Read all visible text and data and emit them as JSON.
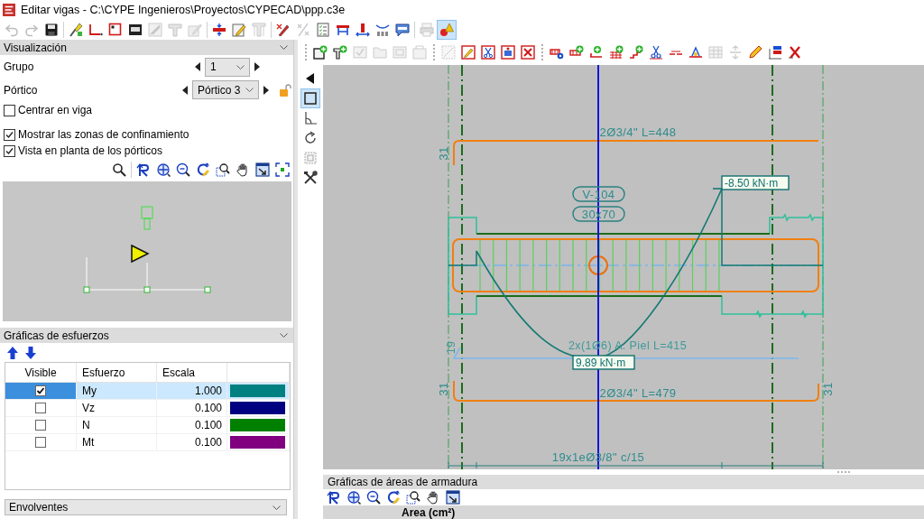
{
  "window": {
    "title": "Editar vigas - C:\\CYPE Ingenieros\\Proyectos\\CYPECAD\\ppp.c3e"
  },
  "toolbar": {
    "buttons": [
      {
        "selected": false,
        "disabled": true
      },
      {
        "selected": false,
        "disabled": true
      },
      {
        "selected": false,
        "disabled": false
      },
      {
        "selected": false,
        "disabled": false
      },
      {
        "selected": false,
        "disabled": false
      },
      {
        "selected": false,
        "disabled": false
      },
      {
        "selected": false,
        "disabled": false
      },
      {
        "selected": false,
        "disabled": true
      },
      {
        "selected": false,
        "disabled": true
      },
      {
        "selected": false,
        "disabled": true
      },
      {
        "selected": false,
        "disabled": false
      },
      {
        "selected": false,
        "disabled": false
      },
      {
        "selected": false,
        "disabled": true
      },
      {
        "selected": false,
        "disabled": false
      },
      {
        "selected": false,
        "disabled": true
      },
      {
        "selected": false,
        "disabled": false
      },
      {
        "selected": false,
        "disabled": false
      },
      {
        "selected": false,
        "disabled": false
      },
      {
        "selected": false,
        "disabled": false
      },
      {
        "selected": false,
        "disabled": false
      },
      {
        "selected": false,
        "disabled": true
      },
      {
        "selected": true,
        "disabled": false
      }
    ]
  },
  "visualization_panel": {
    "title": "Visualización",
    "fields": [
      {
        "label": "Grupo",
        "value": "1"
      },
      {
        "label": "Pórtico",
        "value": "Pórtico 3"
      }
    ],
    "checkboxes": [
      {
        "label": "Centrar en viga",
        "checked": false
      },
      {
        "label": "Mostrar las zonas de confinamiento",
        "checked": true
      },
      {
        "label": "Vista en planta de los pórticos",
        "checked": true
      }
    ]
  },
  "forces_panel": {
    "title": "Gráficas de esfuerzos",
    "columns": [
      "Visible",
      "Esfuerzo",
      "Escala"
    ],
    "rows": [
      {
        "visible": true,
        "name": "My",
        "scale": "1.000",
        "color": "#008080",
        "selected": true
      },
      {
        "visible": false,
        "name": "Vz",
        "scale": "0.100",
        "color": "#000080",
        "selected": false
      },
      {
        "visible": false,
        "name": "N",
        "scale": "0.100",
        "color": "#008000",
        "selected": false
      },
      {
        "visible": false,
        "name": "Mt",
        "scale": "0.100",
        "color": "#800080",
        "selected": false
      }
    ]
  },
  "envelopes_panel": {
    "title": "Envolventes"
  },
  "edit_toolbar": {
    "buttons": [
      {
        "selected": false,
        "disabled": false
      },
      {
        "selected": false,
        "disabled": false
      },
      {
        "selected": false,
        "disabled": true
      },
      {
        "selected": false,
        "disabled": true
      },
      {
        "selected": false,
        "disabled": true
      },
      {
        "selected": false,
        "disabled": true
      },
      {
        "selected": false,
        "disabled": true
      },
      {
        "selected": false,
        "disabled": false
      },
      {
        "selected": false,
        "disabled": false
      },
      {
        "selected": false,
        "disabled": false
      },
      {
        "selected": false,
        "disabled": false
      },
      {
        "selected": false,
        "disabled": false
      },
      {
        "selected": false,
        "disabled": false
      },
      {
        "selected": false,
        "disabled": false
      },
      {
        "selected": false,
        "disabled": false
      },
      {
        "selected": false,
        "disabled": false
      },
      {
        "selected": false,
        "disabled": false
      },
      {
        "selected": false,
        "disabled": false
      },
      {
        "selected": false,
        "disabled": false
      },
      {
        "selected": false,
        "disabled": true
      },
      {
        "selected": false,
        "disabled": true
      },
      {
        "selected": false,
        "disabled": false
      },
      {
        "selected": false,
        "disabled": false
      },
      {
        "selected": false,
        "disabled": false
      }
    ]
  },
  "view_toolbar": {
    "buttons": [
      {
        "selected": false
      },
      {
        "selected": true
      },
      {
        "selected": false
      },
      {
        "selected": false
      },
      {
        "selected": false
      },
      {
        "selected": false
      }
    ]
  },
  "drawing": {
    "beam": {
      "name": "V-104",
      "section": "30x70"
    },
    "top_rebar": {
      "label": "2Ø3/4\" L=448",
      "hook": "31"
    },
    "moments": {
      "negative": "-8.50 kN·m",
      "positive": "9.89 kN·m"
    },
    "skin_rebar": {
      "label": "2x(1Ø6) A. Piel L=415",
      "hook": "19"
    },
    "bottom_rebar": {
      "label": "2Ø3/4\" L=479",
      "hooks": [
        "31",
        "31"
      ]
    },
    "stirrups": {
      "label": "19x1eØ3/8\" c/15"
    }
  },
  "reinforcement_panel": {
    "title": "Gráficas de áreas de armadura",
    "column": "Area (cm²)"
  }
}
